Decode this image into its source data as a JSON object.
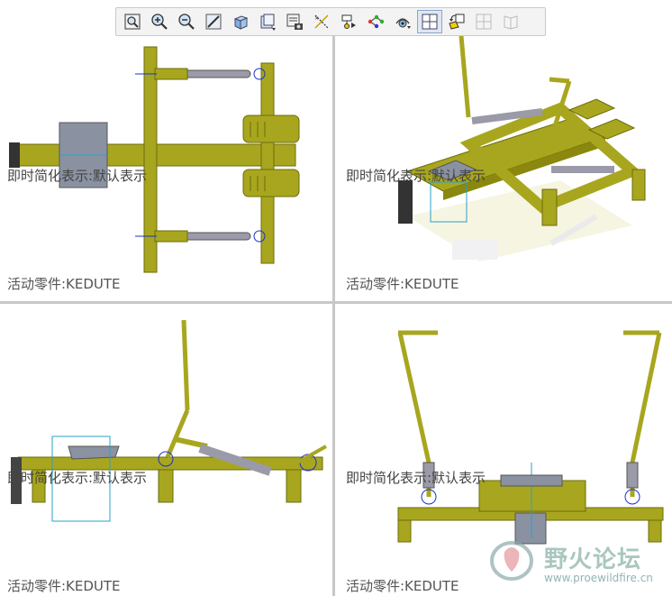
{
  "toolbar": {
    "buttons": [
      {
        "icon": "zoom-window-icon"
      },
      {
        "icon": "zoom-in-icon"
      },
      {
        "icon": "zoom-out-icon"
      },
      {
        "icon": "repaint-icon"
      },
      {
        "icon": "shading-icon"
      },
      {
        "icon": "saved-views-icon"
      },
      {
        "icon": "view-manager-icon"
      },
      {
        "icon": "datum-display-icon"
      },
      {
        "icon": "spin-center-icon"
      },
      {
        "icon": "connection-icon"
      },
      {
        "icon": "perspective-icon"
      },
      {
        "icon": "four-view-icon",
        "active": true
      },
      {
        "icon": "orient-icon"
      },
      {
        "icon": "split-view-icon",
        "disabled": true
      },
      {
        "icon": "book-view-icon",
        "disabled": true
      }
    ]
  },
  "viewports": [
    {
      "name": "top-view",
      "rep_label": "即时简化表示:默认表示",
      "active_part": "活动零件:KEDUTE"
    },
    {
      "name": "iso-view",
      "rep_label": "即时简化表示:默认表示",
      "active_part": "活动零件:KEDUTE"
    },
    {
      "name": "front-view",
      "rep_label": "即时简化表示:默认表示",
      "active_part": "活动零件:KEDUTE"
    },
    {
      "name": "side-view",
      "rep_label": "即时简化表示:默认表示",
      "active_part": "活动零件:KEDUTE"
    }
  ],
  "watermark": {
    "title": "野火论坛",
    "url": "www.proewildfire.cn"
  },
  "colors": {
    "frame": "#a8a61e",
    "frame_dark": "#6e6c0a",
    "cylinder": "#9a9aa8",
    "seat": "#8a92a2",
    "datum": "#1a33c8",
    "cyan": "#2aa0c8"
  }
}
